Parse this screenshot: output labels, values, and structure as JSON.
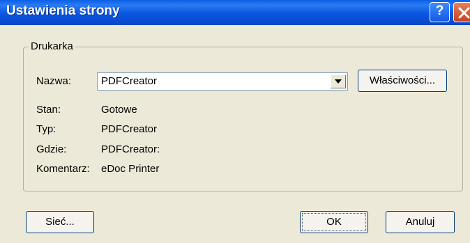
{
  "window": {
    "title": "Ustawienia strony"
  },
  "titlebar": {
    "help_glyph": "?",
    "help_icon": "question-icon",
    "close_icon": "close-icon"
  },
  "printer_group": {
    "label": "Drukarka",
    "name_label": "Nazwa:",
    "name_value": "PDFCreator",
    "properties_button": "Właściwości...",
    "status_label": "Stan:",
    "status_value": "Gotowe",
    "type_label": "Typ:",
    "type_value": "PDFCreator",
    "where_label": "Gdzie:",
    "where_value": "PDFCreator:",
    "comment_label": "Komentarz:",
    "comment_value": "eDoc Printer"
  },
  "buttons": {
    "network": "Sieć...",
    "ok": "OK",
    "cancel": "Anuluj"
  },
  "colors": {
    "titlebar": "#0b55e0",
    "dialog_bg": "#ece9d8",
    "close_button": "#c8401e"
  }
}
